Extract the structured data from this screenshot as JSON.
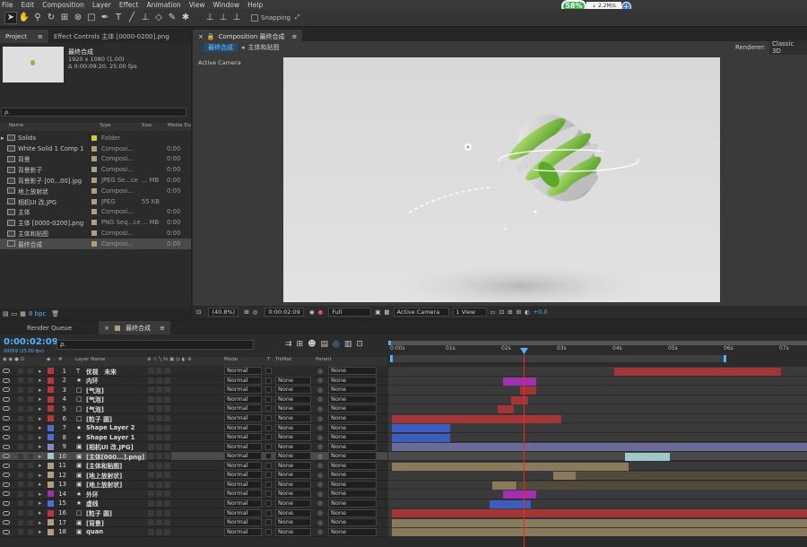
{
  "menu": [
    "File",
    "Edit",
    "Composition",
    "Layer",
    "Effect",
    "Animation",
    "View",
    "Window",
    "Help"
  ],
  "toolbar": {
    "snapping_label": "Snapping"
  },
  "network": {
    "percent": "58%",
    "speed": "2.2M/s",
    "plus": "+"
  },
  "project_panel": {
    "tab_label": "Project",
    "effect_controls_label": "Effect Controls 主体 [0000-0200].png",
    "comp_name": "最终合成",
    "comp_info_1": "1920 x 1080 (1.00)",
    "comp_info_2": "Δ 0:00:09:20, 25.00 fps",
    "search_placeholder": "ρ.",
    "columns": [
      "Name",
      "Type",
      "Size",
      "Media Du"
    ],
    "items": [
      {
        "name": "Solids",
        "type": "Folder",
        "size": "",
        "media": "",
        "label_color": "#d8c838"
      },
      {
        "name": "White Solid 1 Comp 1",
        "type": "Composi...",
        "size": "",
        "media": "0:00",
        "label_color": "#b09f7e"
      },
      {
        "name": "背景",
        "type": "Composi...",
        "size": "",
        "media": "0:00",
        "label_color": "#b09f7e"
      },
      {
        "name": "背景影子",
        "type": "Composi...",
        "size": "",
        "media": "0:00",
        "label_color": "#b09f7e"
      },
      {
        "name": "背景影子 [00...00].jpg",
        "type": "JPEG Se...ce",
        "size": "... MB",
        "media": "0:00",
        "label_color": "#b09f7e"
      },
      {
        "name": "地上放射状",
        "type": "Composi...",
        "size": "",
        "media": "0:00",
        "label_color": "#b09f7e"
      },
      {
        "name": "相机UI 改.JPG",
        "type": "JPEG",
        "size": "55 KB",
        "media": "",
        "label_color": "#b09f7e"
      },
      {
        "name": "主体",
        "type": "Composi...",
        "size": "",
        "media": "0:00",
        "label_color": "#b09f7e"
      },
      {
        "name": "主体 [0000-0200].png",
        "type": "PNG Seq...ce",
        "size": "... MB",
        "media": "0:00",
        "label_color": "#b09f7e"
      },
      {
        "name": "主体和贴图",
        "type": "Composi...",
        "size": "",
        "media": "0:00",
        "label_color": "#b09f7e"
      },
      {
        "name": "最终合成",
        "type": "Composi...",
        "size": "",
        "media": "0:00",
        "label_color": "#b09f7e"
      }
    ],
    "bpc": "8 bpc"
  },
  "comp_panel": {
    "tab_label": "Composition 最终合成",
    "subtab_1": "最终合成",
    "subtab_2": "主体和贴图",
    "renderer_label": "Renderer:",
    "renderer_value": "Classic 3D",
    "view_label": "Active Camera",
    "footer": {
      "zoom": "(40.8%)",
      "timecode": "0:00:02:09",
      "resolution": "Full",
      "camera": "Active Camera",
      "views": "1 View",
      "exposure": "+0.0"
    }
  },
  "timeline": {
    "render_queue_tab": "Render Queue",
    "comp_tab": "最终合成",
    "timecode": "0:00:02:09",
    "frame_info": "00059 (25.00 fps)",
    "search_placeholder": "ρ.",
    "columns": {
      "num": "#",
      "name": "Layer Name",
      "mode": "Mode",
      "t": "T",
      "trkmat": "TrkMat",
      "parent": "Parent"
    },
    "ticks": [
      "0:00s",
      "01s",
      "02s",
      "03s",
      "04s",
      "05s",
      "06s",
      "07s"
    ],
    "layers": [
      {
        "num": "1",
        "name": "优视　未来",
        "color": "#b83838",
        "mode": "Normal",
        "trk": "",
        "parent": "None",
        "icon": "T"
      },
      {
        "num": "2",
        "name": "内环",
        "color": "#b83838",
        "mode": "Normal",
        "trk": "None",
        "parent": "None",
        "icon": "★"
      },
      {
        "num": "3",
        "name": "[气泡]",
        "color": "#b83838",
        "mode": "Normal",
        "trk": "None",
        "parent": "None",
        "icon": "□"
      },
      {
        "num": "4",
        "name": "[气泡]",
        "color": "#b83838",
        "mode": "Normal",
        "trk": "None",
        "parent": "None",
        "icon": "□"
      },
      {
        "num": "5",
        "name": "[气泡]",
        "color": "#b83838",
        "mode": "Normal",
        "trk": "None",
        "parent": "None",
        "icon": "□"
      },
      {
        "num": "6",
        "name": "[粒子 圆]",
        "color": "#b83838",
        "mode": "Normal",
        "trk": "None",
        "parent": "None",
        "icon": "□"
      },
      {
        "num": "7",
        "name": "Shape Layer 2",
        "color": "#4a6fd8",
        "mode": "Normal",
        "trk": "None",
        "parent": "None",
        "icon": "★"
      },
      {
        "num": "8",
        "name": "Shape Layer 1",
        "color": "#4a6fd8",
        "mode": "Normal",
        "trk": "None",
        "parent": "None",
        "icon": "★"
      },
      {
        "num": "9",
        "name": "[相机UI 改.JPG]",
        "color": "#8888c8",
        "mode": "Normal",
        "trk": "None",
        "parent": "None",
        "icon": "▣"
      },
      {
        "num": "10",
        "name": "[主体[000...].png]",
        "color": "#9fc8c8",
        "mode": "Normal",
        "trk": "None",
        "parent": "None",
        "icon": "▣"
      },
      {
        "num": "11",
        "name": "[主体和贴图]",
        "color": "#b09f7e",
        "mode": "Normal",
        "trk": "None",
        "parent": "None",
        "icon": "▣"
      },
      {
        "num": "12",
        "name": "[地上放射状]",
        "color": "#b09f7e",
        "mode": "Normal",
        "trk": "None",
        "parent": "None",
        "icon": "▣"
      },
      {
        "num": "13",
        "name": "[地上放射状]",
        "color": "#b09f7e",
        "mode": "Normal",
        "trk": "None",
        "parent": "None",
        "icon": "▣"
      },
      {
        "num": "14",
        "name": "外环",
        "color": "#a030b0",
        "mode": "Normal",
        "trk": "None",
        "parent": "None",
        "icon": "★"
      },
      {
        "num": "15",
        "name": "虚线",
        "color": "#4a6fd8",
        "mode": "Normal",
        "trk": "None",
        "parent": "None",
        "icon": "★"
      },
      {
        "num": "16",
        "name": "[粒子 圆]",
        "color": "#b83838",
        "mode": "Normal",
        "trk": "None",
        "parent": "None",
        "icon": "□"
      },
      {
        "num": "17",
        "name": "[背景]",
        "color": "#b09f7e",
        "mode": "Normal",
        "trk": "None",
        "parent": "None",
        "icon": "▣"
      },
      {
        "num": "18",
        "name": "quan",
        "color": "#b09f7e",
        "mode": "Normal",
        "trk": "None",
        "parent": "None",
        "icon": "▣"
      }
    ]
  }
}
